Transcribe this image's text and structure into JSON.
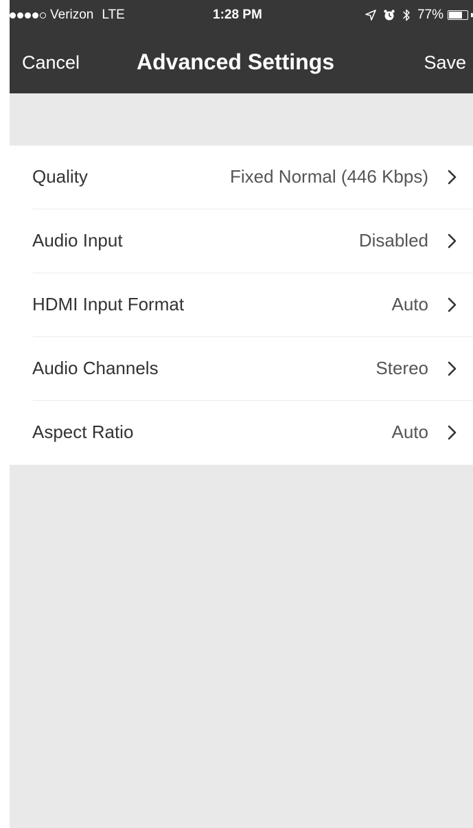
{
  "status_bar": {
    "carrier": "Verizon",
    "network": "LTE",
    "time": "1:28 PM",
    "battery_percent": "77%",
    "battery_level": 0.77,
    "signal_bars_filled": 4,
    "signal_bars_total": 5,
    "icons": [
      "location-arrow-icon",
      "alarm-clock-icon",
      "bluetooth-icon",
      "battery-icon"
    ]
  },
  "nav": {
    "cancel_label": "Cancel",
    "title": "Advanced Settings",
    "save_label": "Save"
  },
  "settings": [
    {
      "label": "Quality",
      "value": "Fixed Normal (446 Kbps)"
    },
    {
      "label": "Audio Input",
      "value": "Disabled"
    },
    {
      "label": "HDMI Input Format",
      "value": "Auto"
    },
    {
      "label": "Audio Channels",
      "value": "Stereo"
    },
    {
      "label": "Aspect Ratio",
      "value": "Auto"
    }
  ],
  "colors": {
    "header_bg": "#373737",
    "page_bg": "#e9e9e9",
    "list_bg": "#ffffff",
    "text": "#333333"
  }
}
